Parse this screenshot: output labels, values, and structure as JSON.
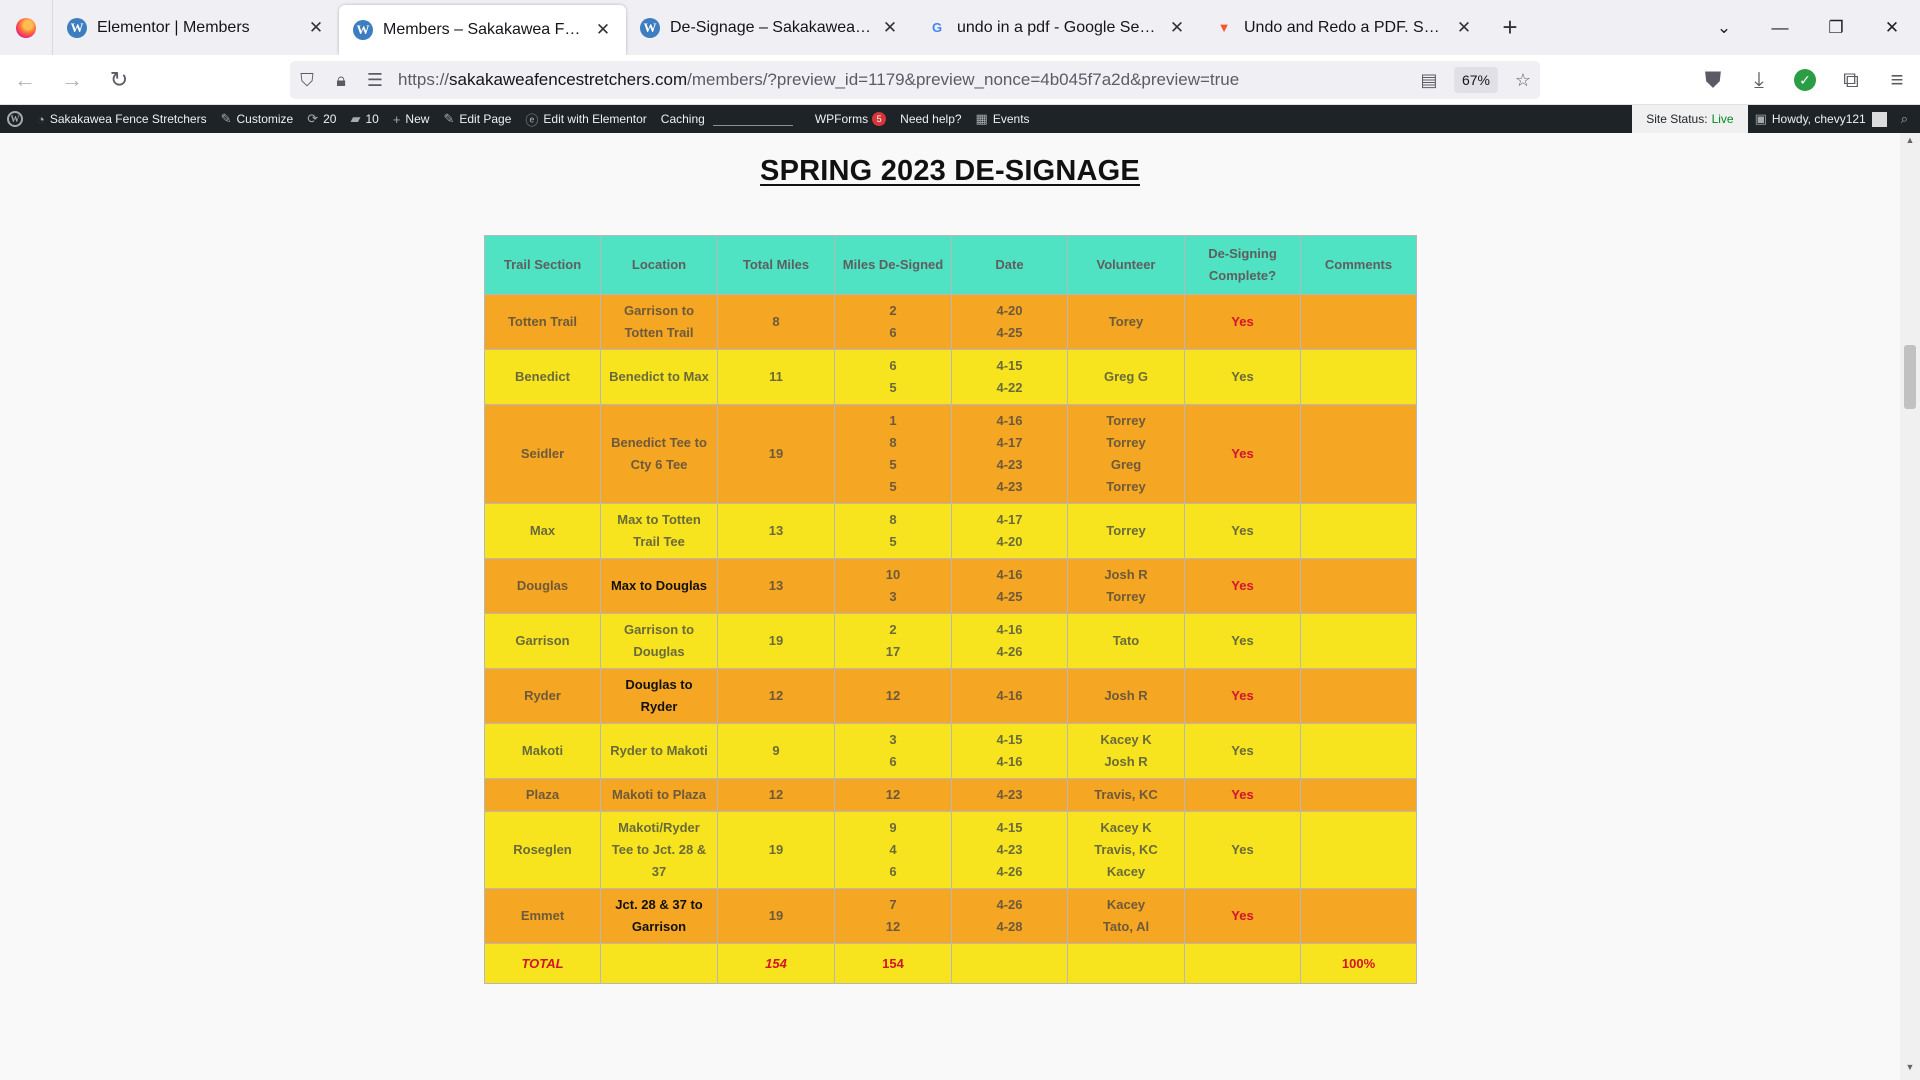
{
  "browser": {
    "tabs": [
      {
        "title": "Elementor | Members",
        "favicon": "wordpress-icon",
        "active": false
      },
      {
        "title": "Members – Sakakawea Fence Stretchers",
        "favicon": "wordpress-icon",
        "active": true
      },
      {
        "title": "De-Signage – Sakakawea Fence Stretchers",
        "favicon": "wordpress-icon",
        "active": false
      },
      {
        "title": "undo in a pdf - Google Search",
        "favicon": "google-icon",
        "active": false
      },
      {
        "title": "Undo and Redo a PDF. Search, Edit",
        "favicon": "brave-icon",
        "active": false
      }
    ],
    "url_prefix": "https://",
    "url_host": "sakakaweafencestretchers.com",
    "url_path": "/members/?preview_id=1179&preview_nonce=4b045f7a2d&preview=true",
    "zoom": "67%"
  },
  "adminbar": {
    "site_name": "Sakakawea Fence Stretchers",
    "customize": "Customize",
    "updates": "20",
    "comments": "10",
    "new": "New",
    "edit_page": "Edit Page",
    "edit_elementor": "Edit with Elementor",
    "caching": "Caching",
    "wpforms": "WPForms",
    "wpforms_badge": "5",
    "need_help": "Need help?",
    "events": "Events",
    "site_status_label": "Site Status:",
    "site_status_value": "Live",
    "howdy": "Howdy, chevy121"
  },
  "page": {
    "title": "SPRING 2023 DE-SIGNAGE",
    "headers": [
      "Trail Section",
      "Location",
      "Total Miles",
      "Miles De-Signed",
      "Date",
      "Volunteer",
      "De-Signing Complete?",
      "Comments"
    ],
    "rows": [
      {
        "section": "Totten Trail",
        "location": "Garrison to Totten Trail",
        "total": "8",
        "miles": [
          "2",
          "6"
        ],
        "dates": [
          "4-20",
          "4-25"
        ],
        "volunteers": [
          "Torey"
        ],
        "complete": "Yes",
        "comments": "",
        "color": "orange",
        "dark_loc": false
      },
      {
        "section": "Benedict",
        "location": "Benedict to Max",
        "total": "11",
        "miles": [
          "6",
          "5"
        ],
        "dates": [
          "4-15",
          "4-22"
        ],
        "volunteers": [
          "Greg G"
        ],
        "complete": "Yes",
        "comments": "",
        "color": "yellow",
        "dark_loc": false
      },
      {
        "section": "Seidler",
        "location": "Benedict Tee to Cty 6 Tee",
        "total": "19",
        "miles": [
          "1",
          "8",
          "5",
          "5"
        ],
        "dates": [
          "4-16",
          "4-17",
          "4-23",
          "4-23"
        ],
        "volunteers": [
          "Torrey",
          "Torrey",
          "Greg",
          "Torrey"
        ],
        "complete": "Yes",
        "comments": "",
        "color": "orange",
        "dark_loc": false
      },
      {
        "section": "Max",
        "location": "Max to Totten Trail Tee",
        "total": "13",
        "miles": [
          "8",
          "5"
        ],
        "dates": [
          "4-17",
          "4-20"
        ],
        "volunteers": [
          "Torrey"
        ],
        "complete": "Yes",
        "comments": "",
        "color": "yellow",
        "dark_loc": true
      },
      {
        "section": "Douglas",
        "location": "Max to Douglas",
        "total": "13",
        "miles": [
          "10",
          "3"
        ],
        "dates": [
          "4-16",
          "4-25"
        ],
        "volunteers": [
          "Josh R",
          "Torrey"
        ],
        "complete": "Yes",
        "comments": "",
        "color": "orange",
        "dark_loc": true
      },
      {
        "section": "Garrison",
        "location": "Garrison to Douglas",
        "total": "19",
        "miles": [
          "2",
          "17"
        ],
        "dates": [
          "4-16",
          "4-26"
        ],
        "volunteers": [
          "Tato"
        ],
        "complete": "Yes",
        "comments": "",
        "color": "yellow",
        "dark_loc": true
      },
      {
        "section": "Ryder",
        "location": "Douglas to Ryder",
        "total": "12",
        "miles": [
          "12"
        ],
        "dates": [
          "4-16"
        ],
        "volunteers": [
          "Josh R"
        ],
        "complete": "Yes",
        "comments": "",
        "color": "orange",
        "dark_loc": true
      },
      {
        "section": "Makoti",
        "location": "Ryder to Makoti",
        "total": "9",
        "miles": [
          "3",
          "6"
        ],
        "dates": [
          "4-15",
          "4-16"
        ],
        "volunteers": [
          "Kacey K",
          "Josh R"
        ],
        "complete": "Yes",
        "comments": "",
        "color": "yellow",
        "dark_loc": true
      },
      {
        "section": "Plaza",
        "location": "Makoti to Plaza",
        "total": "12",
        "miles": [
          "12"
        ],
        "dates": [
          "4-23"
        ],
        "volunteers": [
          "Travis, KC"
        ],
        "complete": "Yes",
        "comments": "",
        "color": "orange",
        "dark_loc": false
      },
      {
        "section": "Roseglen",
        "location": "Makoti/Ryder Tee to Jct. 28 & 37",
        "total": "19",
        "miles": [
          "9",
          "4",
          "6"
        ],
        "dates": [
          "4-15",
          "4-23",
          "4-26"
        ],
        "volunteers": [
          "Kacey K",
          "Travis, KC",
          "Kacey"
        ],
        "complete": "Yes",
        "comments": "",
        "color": "yellow",
        "dark_loc": true
      },
      {
        "section": "Emmet",
        "location": "Jct. 28 & 37 to Garrison",
        "total": "19",
        "miles": [
          "7",
          "12"
        ],
        "dates": [
          "4-26",
          "4-28"
        ],
        "volunteers": [
          "Kacey",
          "Tato, Al"
        ],
        "complete": "Yes",
        "comments": "",
        "color": "orange",
        "dark_loc": true
      }
    ],
    "total_row": {
      "label": "TOTAL",
      "total_miles": "154",
      "miles_designed": "154",
      "percent": "100%"
    }
  },
  "colors": {
    "header": "#4fe3c4",
    "orange": "#f5a623",
    "yellow": "#f7e41e",
    "yes": "#d4142a"
  }
}
